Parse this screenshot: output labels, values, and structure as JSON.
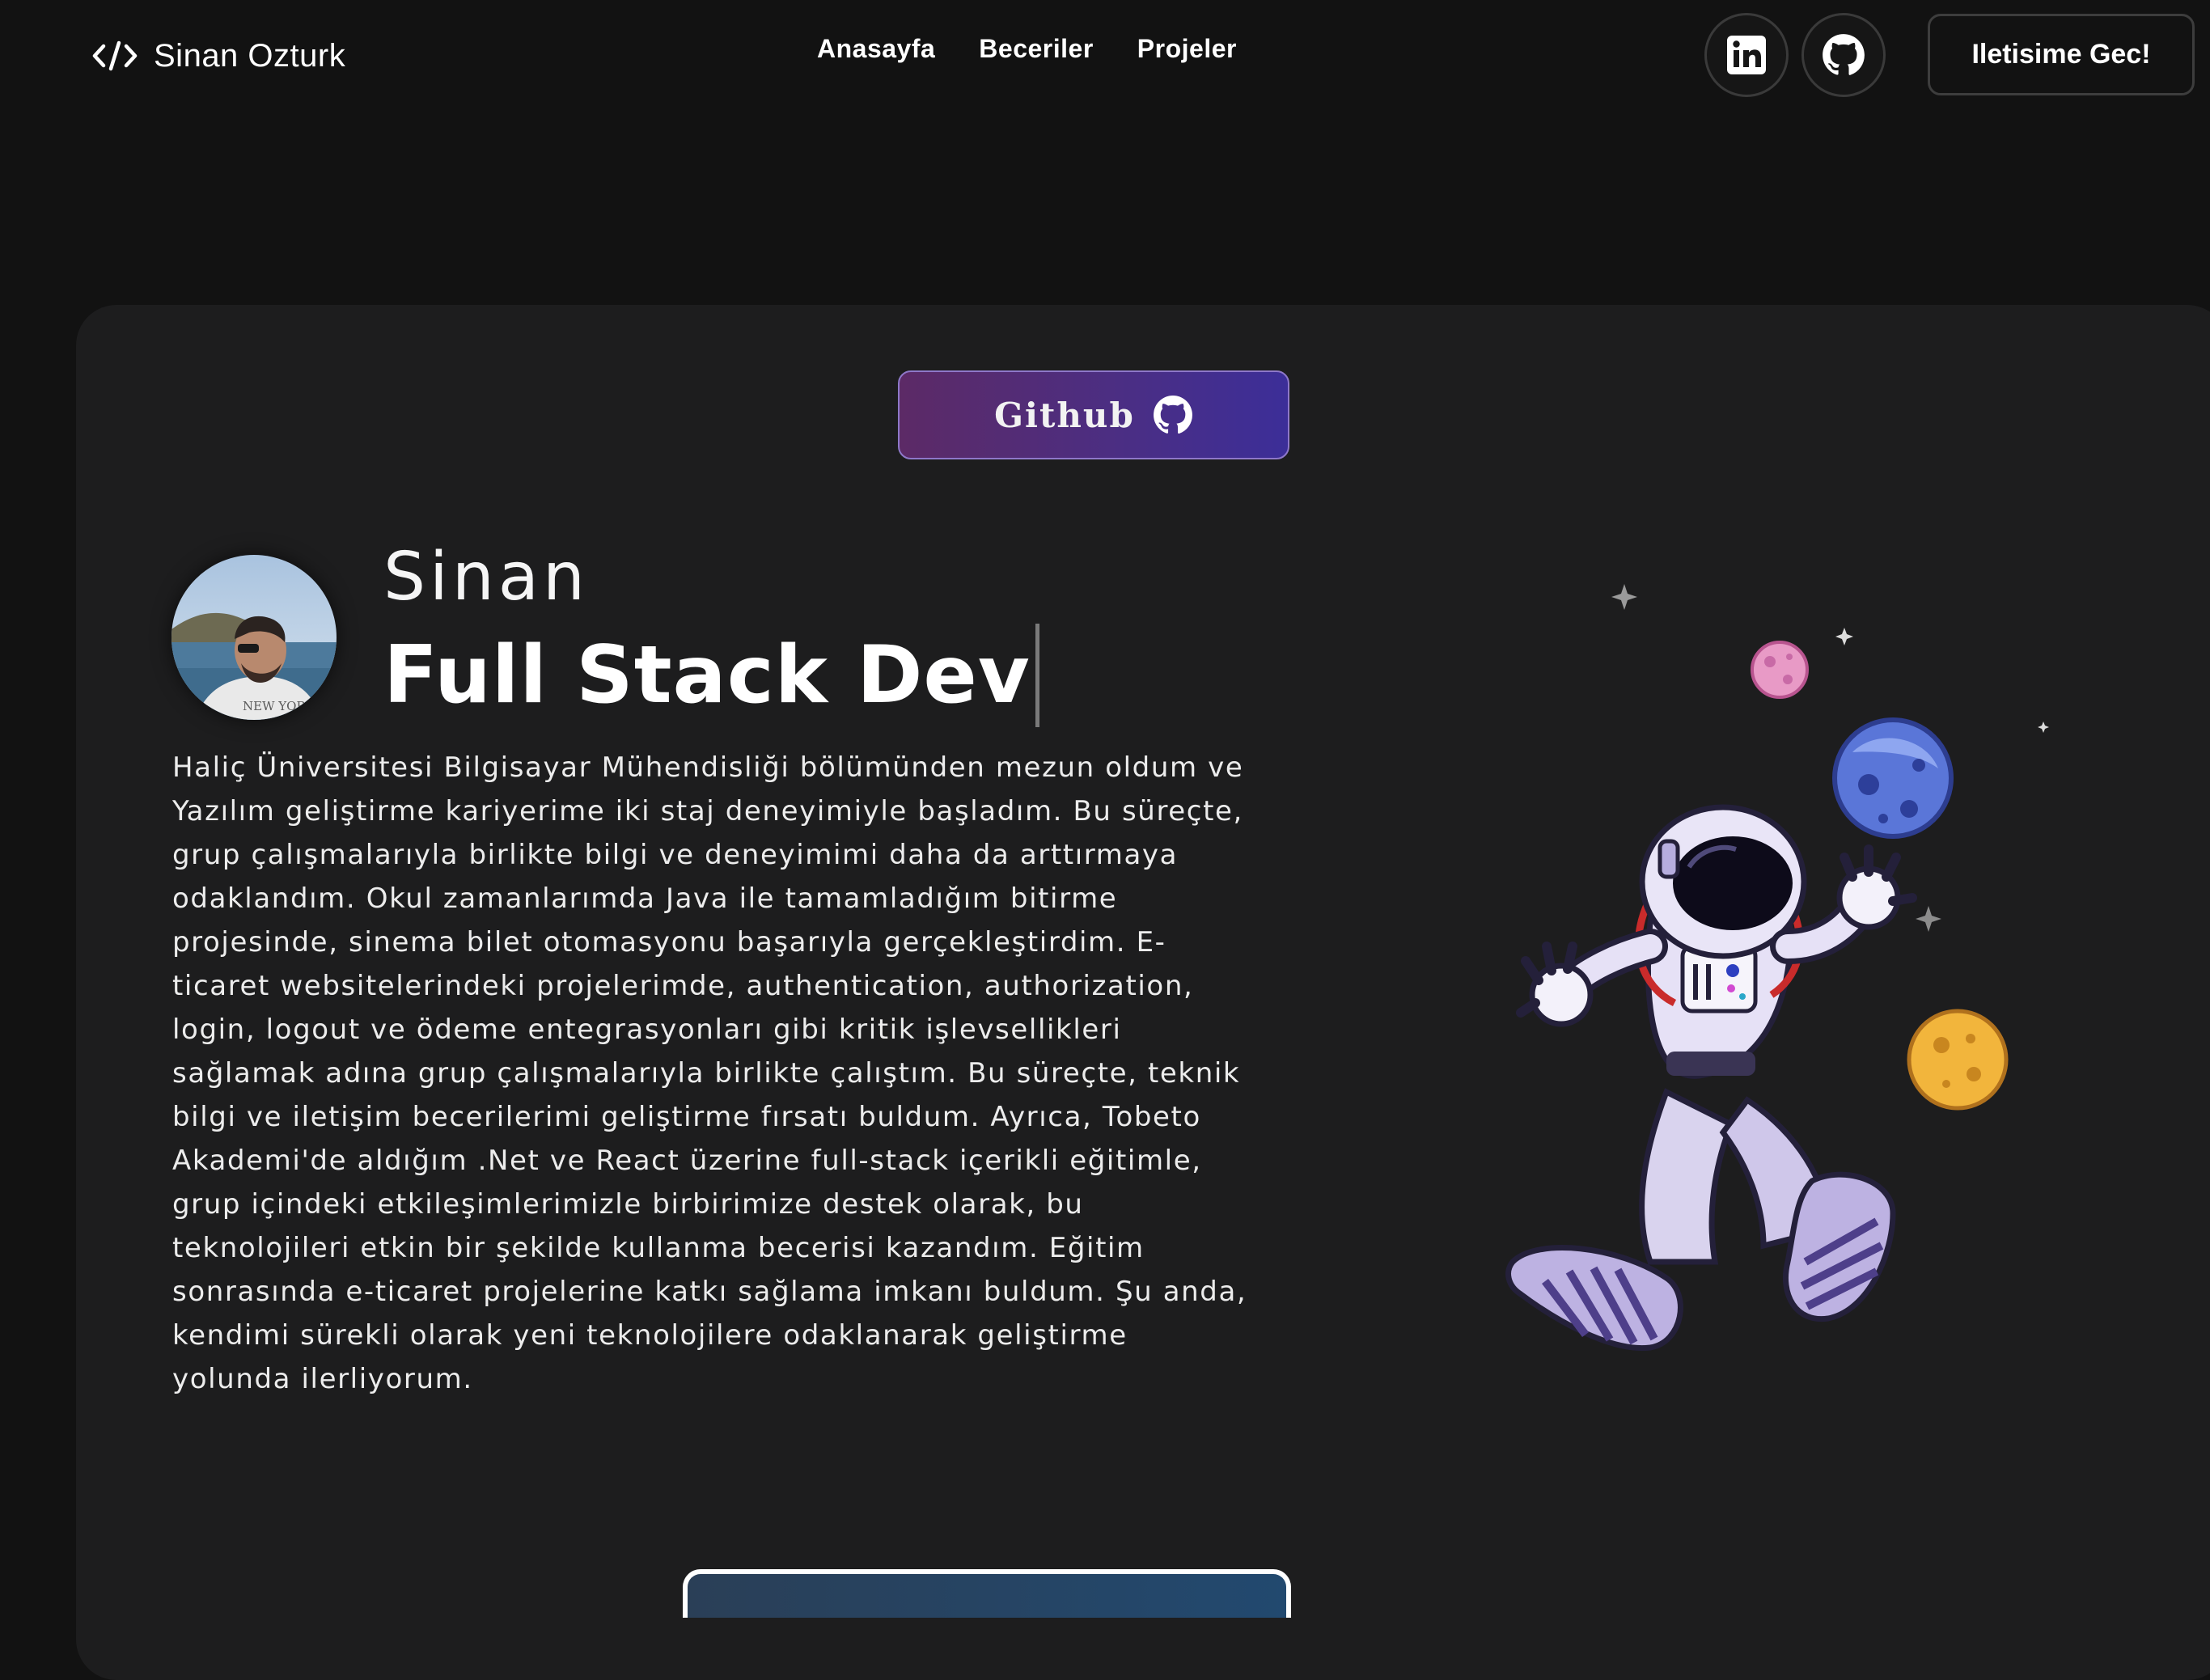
{
  "header": {
    "brand_name": "Sinan Ozturk",
    "brand_icon": "code-icon",
    "nav": [
      {
        "label": "Anasayfa"
      },
      {
        "label": "Beceriler"
      },
      {
        "label": "Projeler"
      }
    ],
    "social": [
      {
        "icon": "linkedin-icon"
      },
      {
        "icon": "github-icon"
      }
    ],
    "contact_label": "Iletisime Gec!"
  },
  "hero": {
    "github_button_label": "Github",
    "greeting": "Sinan",
    "role": "Full Stack Dev",
    "bio": "Haliç Üniversitesi Bilgisayar Mühendisliği bölümünden mezun oldum ve Yazılım geliştirme kariyerime iki staj deneyimiyle başladım. Bu süreçte, grup çalışmalarıyla birlikte bilgi ve deneyimimi daha da arttırmaya odaklandım. Okul zamanlarımda Java ile tamamladığım bitirme projesinde, sinema bilet otomasyonu başarıyla gerçekleştirdim. E-ticaret websitelerindeki projelerimde, authentication, authorization, login, logout ve ödeme entegrasyonları gibi kritik işlevsellikleri sağlamak adına grup çalışmalarıyla birlikte çalıştım. Bu süreçte, teknik bilgi ve iletişim becerilerimi geliştirme fırsatı buldum. Ayrıca, Tobeto Akademi'de aldığım .Net ve React üzerine full-stack içerikli eğitimle, grup içindeki etkileşimlerimizle birbirimize destek olarak, bu teknolojileri etkin bir şekilde kullanma becerisi kazandım. Eğitim sonrasında e-ticaret projelerine katkı sağlama imkanı buldum. Şu anda, kendimi sürekli olarak yeni teknolojilere odaklanarak geliştirme yolunda ilerliyorum."
  },
  "colors": {
    "background": "#121212",
    "panel": "#1d1d1e",
    "accent_gradient_start": "#5c2a66",
    "accent_gradient_end": "#3c2e98"
  }
}
